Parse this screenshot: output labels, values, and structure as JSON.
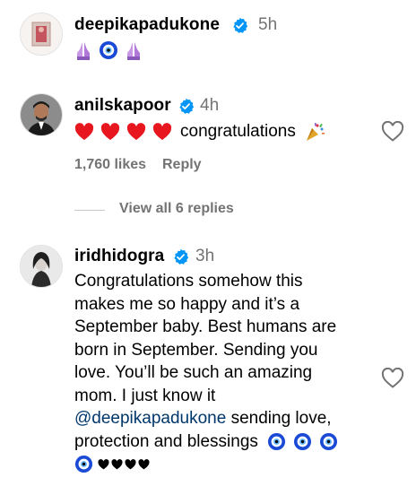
{
  "comments": [
    {
      "username": "deepikapadukone",
      "time": "5h",
      "text": "",
      "emojis": [
        "praying-hands",
        "evil-eye",
        "praying-hands"
      ]
    },
    {
      "username": "anilskapoor",
      "time": "4h",
      "text": "congratulations",
      "emojis_before": [
        "red-heart",
        "red-heart",
        "red-heart",
        "red-heart"
      ],
      "emoji_after": "party-popper",
      "likes": "1,760 likes",
      "reply_label": "Reply",
      "view_replies": "View all 6 replies"
    },
    {
      "username": "iridhidogra",
      "time": "3h",
      "lines": [
        "Congratulations somehow this",
        "makes me so happy and it’s a",
        "September baby. Best humans are",
        "born in September. Sending you",
        "love. You’ll be such an amazing",
        "mom. I just know it"
      ],
      "mention": "@deepikapadukone",
      "after_mention": " sending love,",
      "last_line": "protection and blessings",
      "final_emojis": [
        "evil-eye",
        "black-heart",
        "black-heart",
        "black-heart",
        "black-heart"
      ]
    }
  ],
  "colors": {
    "verified": "#0095f6",
    "muted": "#737373",
    "mention": "#00376b",
    "heart": "#ff3040"
  }
}
